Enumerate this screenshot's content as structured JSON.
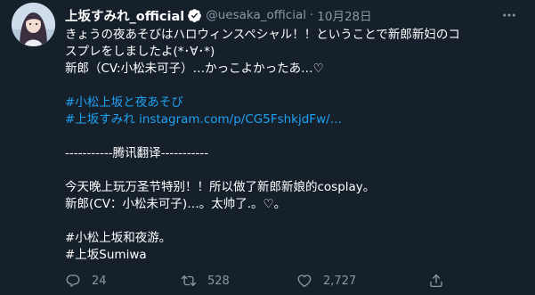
{
  "tweet": {
    "display_name": "上坂すみれ_official",
    "handle": "@uesaka_official",
    "separator": "·",
    "timestamp": "10月28日",
    "lines": [
      {
        "text": "きょうの夜あそびはハロウィンスペシャル！！ということで新郎新妇のコ",
        "style": ""
      },
      {
        "text": "スプレをしましたよ(*･∀･*)",
        "style": ""
      },
      {
        "text": "新郎（CV:小松未可子）…かっこよかったあ…♡",
        "style": ""
      },
      {
        "text": "",
        "style": "blank"
      },
      {
        "text": "#小松上坂と夜あそび",
        "style": "link"
      },
      {
        "text": "#上坂すみれ instagram.com/p/CG5FshkjdFw/…",
        "style": "link"
      },
      {
        "text": "",
        "style": "blank"
      },
      {
        "text": "-----------腾讯翻译-----------",
        "style": ""
      },
      {
        "text": "",
        "style": "blank"
      },
      {
        "text": "今天晚上玩万圣节特别！！所以做了新郎新娘的cosplay。",
        "style": ""
      },
      {
        "text": "新郎(CV：小松未可子)…。太帅了.。♡。",
        "style": ""
      },
      {
        "text": "",
        "style": "blank"
      },
      {
        "text": "#小松上坂和夜游。",
        "style": ""
      },
      {
        "text": "#上坂Sumiwa",
        "style": ""
      }
    ]
  },
  "actions": {
    "reply_count": "24",
    "retweet_count": "528",
    "like_count": "2,727",
    "reply_icon": "reply-icon",
    "retweet_icon": "retweet-icon",
    "like_icon": "heart-icon",
    "share_icon": "share-icon"
  },
  "colors": {
    "background": "#15202b",
    "text": "#ffffff",
    "muted": "#8899a6",
    "link": "#1da1f2"
  }
}
